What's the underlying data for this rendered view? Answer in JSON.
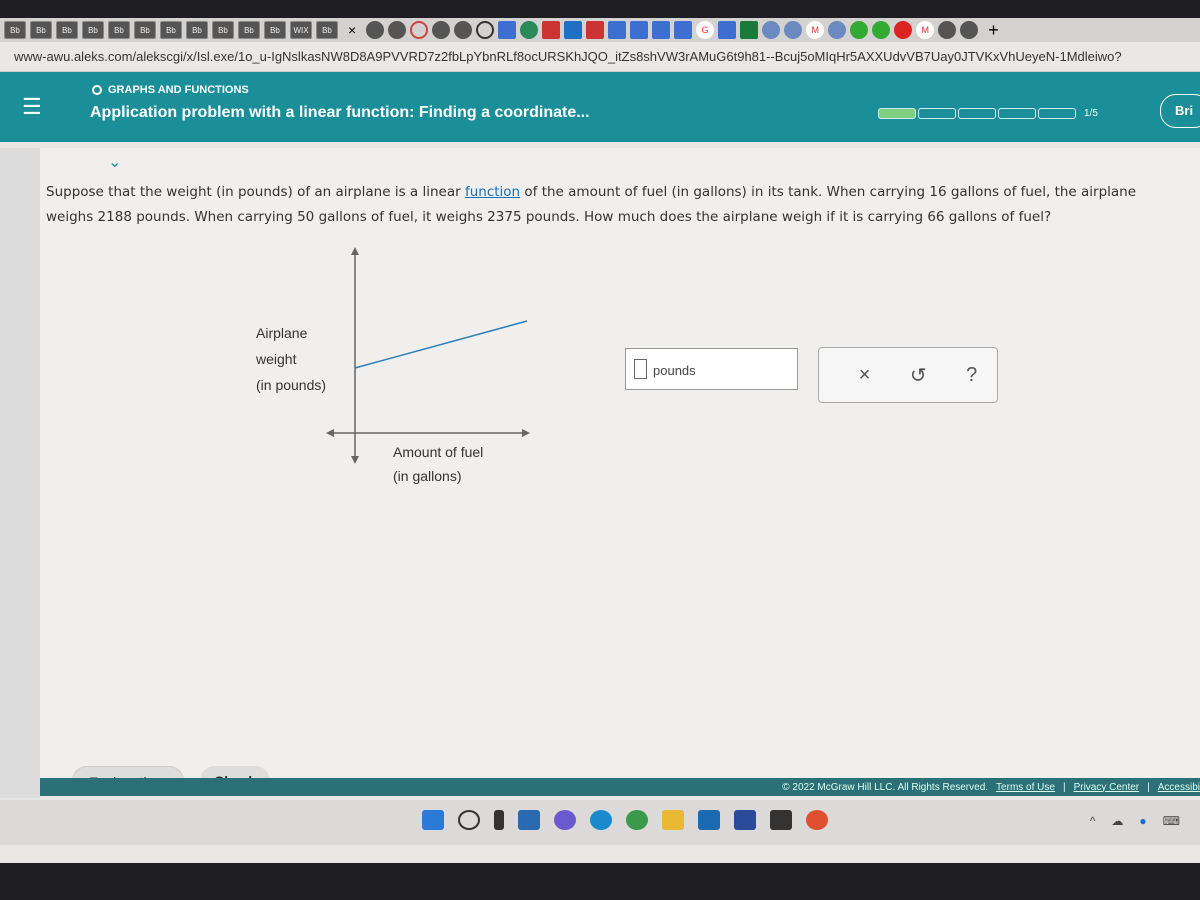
{
  "browser": {
    "tabs": [
      "Bb",
      "Bb",
      "Bb",
      "Bb",
      "Bb",
      "Bb",
      "Bb",
      "Bb",
      "Bb",
      "Bb",
      "Bb",
      "WIX",
      "Bb"
    ],
    "close_label": "×",
    "new_tab_label": "+",
    "url": "www-awu.aleks.com/alekscgi/x/Isl.exe/1o_u-IgNslkasNW8D8A9PVVRD7z2fbLpYbnRLf8ocURSKhJQO_itZs8shVW3rAMuG6t9h81--Bcuj5oMIqHr5AXXUdvVB7Uay0JTVKxVhUeyeN-1Mdleiwo?"
  },
  "header": {
    "menu_icon": "☰",
    "topic": "GRAPHS AND FUNCTIONS",
    "title": "Application problem with a linear function: Finding a coordinate...",
    "progress": {
      "completed": 1,
      "total": 5,
      "label": "1/5"
    },
    "brief_label": "Bri"
  },
  "question": {
    "part1": "Suppose that the weight (in pounds) of an airplane is a linear ",
    "link": "function",
    "part2": " of the amount of fuel (in gallons) in its tank. When carrying 16 gallons of fuel, the airplane weighs 2188 pounds. When carrying 50 gallons of fuel, it weighs 2375 pounds. How much does the airplane weigh if it is carrying 66 gallons of fuel?"
  },
  "graph": {
    "y_label": [
      "Airplane",
      "weight",
      "(in pounds)"
    ],
    "x_label": [
      "Amount of fuel",
      "(in gallons)"
    ]
  },
  "answer": {
    "value": "",
    "unit": "pounds"
  },
  "tools": {
    "clear": "×",
    "undo": "↺",
    "help": "?"
  },
  "buttons": {
    "explanation": "Explanation",
    "check": "Check"
  },
  "footer": {
    "copyright": "© 2022 McGraw Hill LLC. All Rights Reserved.",
    "terms": "Terms of Use",
    "privacy": "Privacy Center",
    "accessibility": "Accessibi"
  },
  "colors": {
    "header": "#1b8f99",
    "progress_done": "#7fcf7f",
    "link": "#1a6fb0"
  }
}
